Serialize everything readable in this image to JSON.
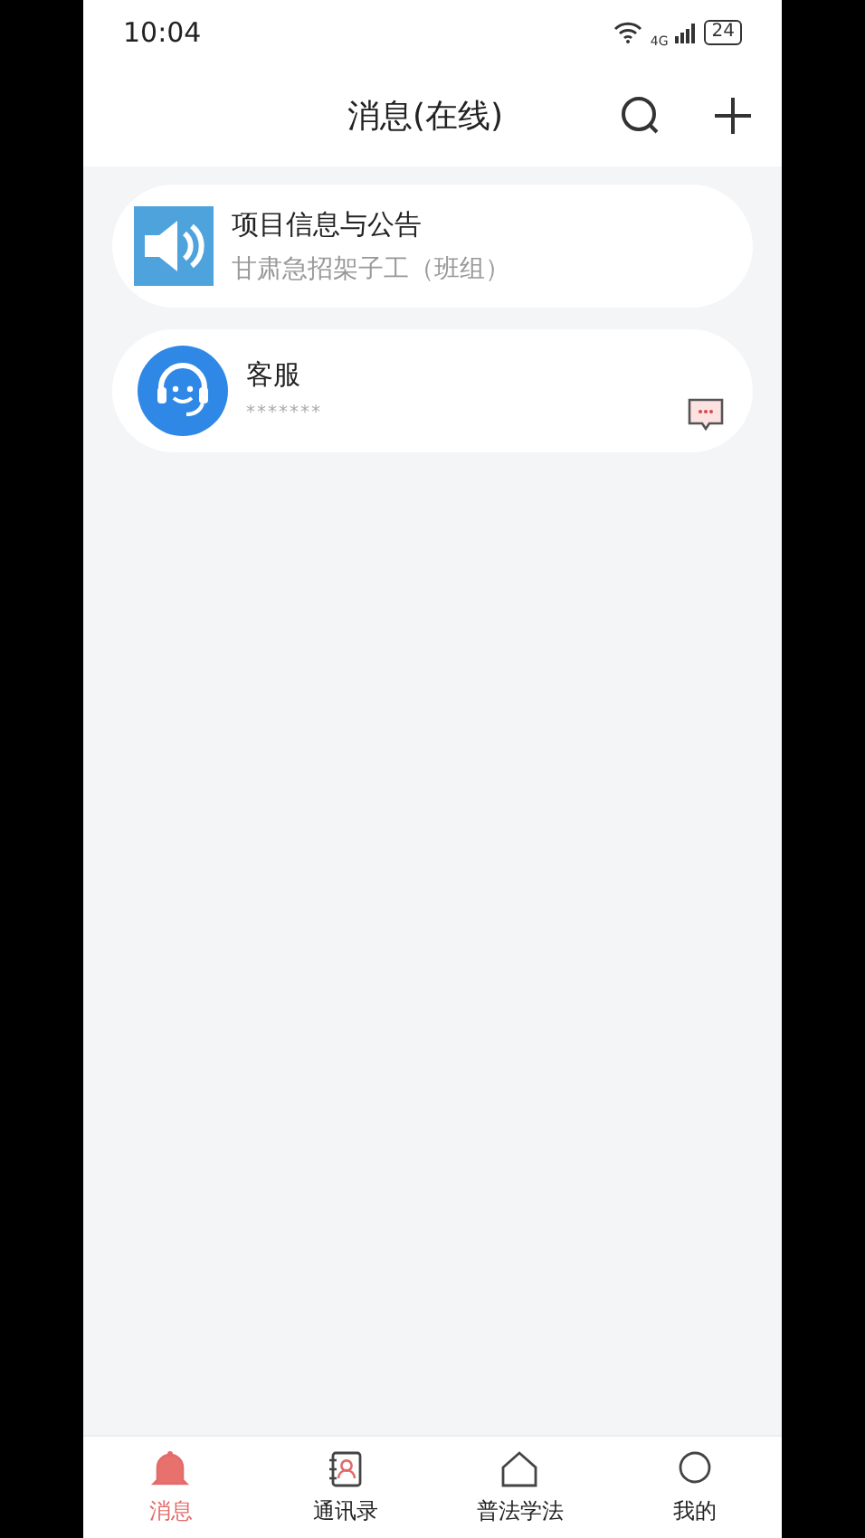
{
  "status_bar": {
    "time": "10:04",
    "network": "4G",
    "battery": "24"
  },
  "header": {
    "title": "消息(在线)"
  },
  "conversations": [
    {
      "kind": "announcement",
      "title": "项目信息与公告",
      "subtitle": "甘肃急招架子工（班组）",
      "has_message_badge": false
    },
    {
      "kind": "service",
      "title": "客服",
      "subtitle": "*******",
      "has_message_badge": true
    }
  ],
  "tabs": [
    {
      "kind": "bell",
      "label": "消息",
      "selected": true
    },
    {
      "kind": "contacts",
      "label": "通讯录",
      "selected": false
    },
    {
      "kind": "home",
      "label": "普法学法",
      "selected": false
    },
    {
      "kind": "person",
      "label": "我的",
      "selected": false
    }
  ]
}
